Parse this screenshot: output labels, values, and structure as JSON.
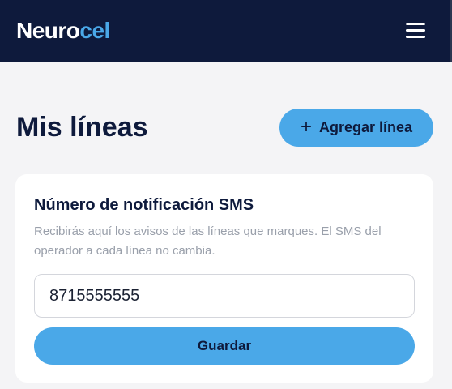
{
  "header": {
    "logo_part1": "Neuro",
    "logo_part2": "cel",
    "menu_icon": "hamburger-menu-icon"
  },
  "main": {
    "title": "Mis líneas",
    "add_button": {
      "icon": "plus-icon",
      "icon_glyph": "+",
      "label": "Agregar línea"
    }
  },
  "sms_card": {
    "title": "Número de notificación SMS",
    "description": "Recibirás aquí los avisos de las líneas que marques. El SMS del operador a cada línea no cambia.",
    "phone_value": "8715555555",
    "save_label": "Guardar"
  },
  "colors": {
    "header_bg": "#0e1a3c",
    "accent": "#4aa8e8",
    "page_bg": "#f4f4f6"
  }
}
